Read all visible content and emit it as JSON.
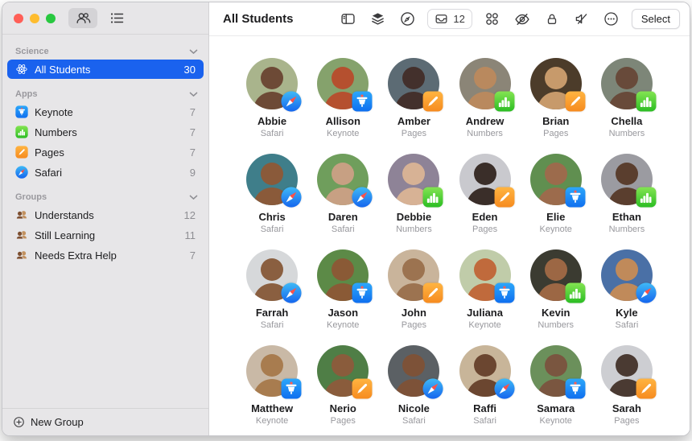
{
  "colors": {
    "accent": "#1a62ee",
    "sidebar_bg": "#e7e6e8",
    "badge_safari_top": "#3fb9f6",
    "badge_safari_bottom": "#1566ee",
    "badge_keynote_top": "#2ca7fa",
    "badge_keynote_bottom": "#0f6fef",
    "badge_pages_top": "#ffb441",
    "badge_pages_bottom": "#f68b1f",
    "badge_numbers_top": "#84e452",
    "badge_numbers_bottom": "#2bbd23"
  },
  "window": {
    "traffic_light_colors": [
      "#ff5f57",
      "#febc2e",
      "#28c840"
    ]
  },
  "sidebar": {
    "view_buttons": [
      {
        "name": "people-view",
        "active": true
      },
      {
        "name": "list-view",
        "active": false
      }
    ],
    "sections": [
      {
        "label": "Science",
        "items": [
          {
            "icon": "class",
            "label": "All Students",
            "count": "30",
            "selected": true
          }
        ]
      },
      {
        "label": "Apps",
        "items": [
          {
            "icon": "keynote",
            "label": "Keynote",
            "count": "7"
          },
          {
            "icon": "numbers",
            "label": "Numbers",
            "count": "7"
          },
          {
            "icon": "pages",
            "label": "Pages",
            "count": "7"
          },
          {
            "icon": "safari",
            "label": "Safari",
            "count": "9"
          }
        ]
      },
      {
        "label": "Groups",
        "items": [
          {
            "icon": "group",
            "label": "Understands",
            "count": "12"
          },
          {
            "icon": "group",
            "label": "Still Learning",
            "count": "11"
          },
          {
            "icon": "group",
            "label": "Needs Extra Help",
            "count": "7"
          }
        ]
      }
    ],
    "new_group_label": "New Group"
  },
  "header": {
    "title": "All Students",
    "invite_count": "12",
    "select_label": "Select",
    "toolbar_icons": [
      "sidebar-toggle",
      "layers",
      "compass",
      "invite-tray",
      "app-grid",
      "hide-screen",
      "lock",
      "mute",
      "more"
    ]
  },
  "students": [
    {
      "name": "Abbie",
      "app": "Safari",
      "avatar": {
        "bg": "#a9b48c",
        "fg": "#6d4a36"
      }
    },
    {
      "name": "Allison",
      "app": "Keynote",
      "avatar": {
        "bg": "#85a26c",
        "fg": "#b5502f"
      }
    },
    {
      "name": "Amber",
      "app": "Pages",
      "avatar": {
        "bg": "#5c6b74",
        "fg": "#43302c"
      }
    },
    {
      "name": "Andrew",
      "app": "Numbers",
      "avatar": {
        "bg": "#8b8577",
        "fg": "#b9895e"
      }
    },
    {
      "name": "Brian",
      "app": "Pages",
      "avatar": {
        "bg": "#4c3c2a",
        "fg": "#c79a6b"
      }
    },
    {
      "name": "Chella",
      "app": "Numbers",
      "avatar": {
        "bg": "#7d8678",
        "fg": "#684a3a"
      }
    },
    {
      "name": "Chris",
      "app": "Safari",
      "avatar": {
        "bg": "#3f7e8a",
        "fg": "#8a5a3a"
      }
    },
    {
      "name": "Daren",
      "app": "Safari",
      "avatar": {
        "bg": "#6f9e5c",
        "fg": "#c7a083"
      }
    },
    {
      "name": "Debbie",
      "app": "Numbers",
      "avatar": {
        "bg": "#8e8397",
        "fg": "#d7b295"
      }
    },
    {
      "name": "Eden",
      "app": "Pages",
      "avatar": {
        "bg": "#c9c9ce",
        "fg": "#3a2e29"
      }
    },
    {
      "name": "Elie",
      "app": "Keynote",
      "avatar": {
        "bg": "#608f50",
        "fg": "#9c6b4c"
      }
    },
    {
      "name": "Ethan",
      "app": "Numbers",
      "avatar": {
        "bg": "#9b9ba1",
        "fg": "#5a3e2e"
      }
    },
    {
      "name": "Farrah",
      "app": "Safari",
      "avatar": {
        "bg": "#d6d8da",
        "fg": "#8a5f40"
      }
    },
    {
      "name": "Jason",
      "app": "Keynote",
      "avatar": {
        "bg": "#5c8a47",
        "fg": "#8a5a36"
      }
    },
    {
      "name": "John",
      "app": "Pages",
      "avatar": {
        "bg": "#c9b49b",
        "fg": "#9c7350"
      }
    },
    {
      "name": "Juliana",
      "app": "Keynote",
      "avatar": {
        "bg": "#c0cca9",
        "fg": "#c06a3c"
      }
    },
    {
      "name": "Kevin",
      "app": "Numbers",
      "avatar": {
        "bg": "#3b3b31",
        "fg": "#9c6744"
      }
    },
    {
      "name": "Kyle",
      "app": "Safari",
      "avatar": {
        "bg": "#4a70a6",
        "fg": "#c08a5a"
      }
    },
    {
      "name": "Matthew",
      "app": "Keynote",
      "avatar": {
        "bg": "#c9b9a6",
        "fg": "#a87c4f"
      }
    },
    {
      "name": "Nerio",
      "app": "Pages",
      "avatar": {
        "bg": "#4f7e46",
        "fg": "#8a5c3c"
      }
    },
    {
      "name": "Nicole",
      "app": "Safari",
      "avatar": {
        "bg": "#5b6064",
        "fg": "#7d5238"
      }
    },
    {
      "name": "Raffi",
      "app": "Safari",
      "avatar": {
        "bg": "#c8b599",
        "fg": "#6b4630"
      }
    },
    {
      "name": "Samara",
      "app": "Keynote",
      "avatar": {
        "bg": "#6b905b",
        "fg": "#7a5640"
      }
    },
    {
      "name": "Sarah",
      "app": "Pages",
      "avatar": {
        "bg": "#cdced2",
        "fg": "#4a3a32"
      }
    }
  ]
}
